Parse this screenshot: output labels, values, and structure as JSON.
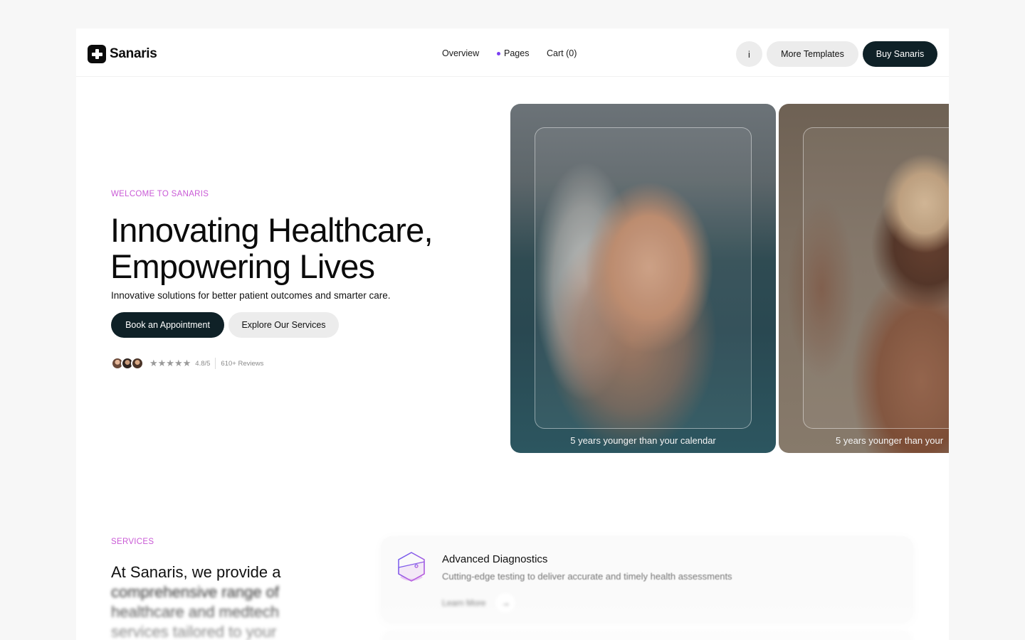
{
  "nav": {
    "brand": "Sanaris",
    "links": [
      {
        "label": "Overview"
      },
      {
        "label": "Pages"
      },
      {
        "label": "Cart (0)"
      }
    ],
    "info_label": "i",
    "more_templates_label": "More Templates",
    "buy_label": "Buy Sanaris"
  },
  "hero": {
    "eyebrow": "WELCOME TO SANARIS",
    "title_line1": "Innovating Healthcare,",
    "title_line2": "Empowering Lives",
    "subtitle": "Innovative solutions for better patient outcomes and smarter care.",
    "primary_button": "Book an Appointment",
    "secondary_button": "Explore Our Services",
    "reviews": {
      "stars": "★★★★★",
      "rating": "4.8/5",
      "count": "610+ Reviews"
    }
  },
  "cards": [
    {
      "caption": "5 years younger than your calendar"
    },
    {
      "caption": "5 years younger than your"
    }
  ],
  "services": {
    "eyebrow": "SERVICES",
    "title_visible": "At Sanaris, we provide a",
    "title_blurred": "comprehensive range of healthcare and medtech services tailored to your",
    "items": [
      {
        "title": "Advanced Diagnostics",
        "description": "Cutting-edge testing to deliver accurate and timely health assessments",
        "link_label": "Learn More"
      }
    ]
  },
  "colors": {
    "accent_eyebrow": "#c95ad6",
    "primary_dark": "#0f2127",
    "pages_dot": "#7b3ff2",
    "button_light": "#ececec"
  }
}
